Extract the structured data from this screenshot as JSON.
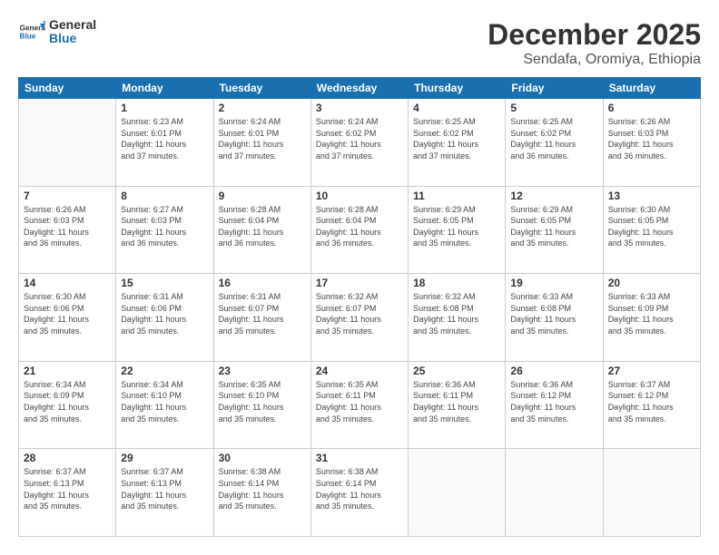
{
  "header": {
    "logo_general": "General",
    "logo_blue": "Blue",
    "month_year": "December 2025",
    "location": "Sendafa, Oromiya, Ethiopia"
  },
  "weekdays": [
    "Sunday",
    "Monday",
    "Tuesday",
    "Wednesday",
    "Thursday",
    "Friday",
    "Saturday"
  ],
  "weeks": [
    [
      {
        "day": "",
        "info": ""
      },
      {
        "day": "1",
        "info": "Sunrise: 6:23 AM\nSunset: 6:01 PM\nDaylight: 11 hours\nand 37 minutes."
      },
      {
        "day": "2",
        "info": "Sunrise: 6:24 AM\nSunset: 6:01 PM\nDaylight: 11 hours\nand 37 minutes."
      },
      {
        "day": "3",
        "info": "Sunrise: 6:24 AM\nSunset: 6:02 PM\nDaylight: 11 hours\nand 37 minutes."
      },
      {
        "day": "4",
        "info": "Sunrise: 6:25 AM\nSunset: 6:02 PM\nDaylight: 11 hours\nand 37 minutes."
      },
      {
        "day": "5",
        "info": "Sunrise: 6:25 AM\nSunset: 6:02 PM\nDaylight: 11 hours\nand 36 minutes."
      },
      {
        "day": "6",
        "info": "Sunrise: 6:26 AM\nSunset: 6:03 PM\nDaylight: 11 hours\nand 36 minutes."
      }
    ],
    [
      {
        "day": "7",
        "info": "Sunrise: 6:26 AM\nSunset: 6:03 PM\nDaylight: 11 hours\nand 36 minutes."
      },
      {
        "day": "8",
        "info": "Sunrise: 6:27 AM\nSunset: 6:03 PM\nDaylight: 11 hours\nand 36 minutes."
      },
      {
        "day": "9",
        "info": "Sunrise: 6:28 AM\nSunset: 6:04 PM\nDaylight: 11 hours\nand 36 minutes."
      },
      {
        "day": "10",
        "info": "Sunrise: 6:28 AM\nSunset: 6:04 PM\nDaylight: 11 hours\nand 36 minutes."
      },
      {
        "day": "11",
        "info": "Sunrise: 6:29 AM\nSunset: 6:05 PM\nDaylight: 11 hours\nand 35 minutes."
      },
      {
        "day": "12",
        "info": "Sunrise: 6:29 AM\nSunset: 6:05 PM\nDaylight: 11 hours\nand 35 minutes."
      },
      {
        "day": "13",
        "info": "Sunrise: 6:30 AM\nSunset: 6:05 PM\nDaylight: 11 hours\nand 35 minutes."
      }
    ],
    [
      {
        "day": "14",
        "info": "Sunrise: 6:30 AM\nSunset: 6:06 PM\nDaylight: 11 hours\nand 35 minutes."
      },
      {
        "day": "15",
        "info": "Sunrise: 6:31 AM\nSunset: 6:06 PM\nDaylight: 11 hours\nand 35 minutes."
      },
      {
        "day": "16",
        "info": "Sunrise: 6:31 AM\nSunset: 6:07 PM\nDaylight: 11 hours\nand 35 minutes."
      },
      {
        "day": "17",
        "info": "Sunrise: 6:32 AM\nSunset: 6:07 PM\nDaylight: 11 hours\nand 35 minutes."
      },
      {
        "day": "18",
        "info": "Sunrise: 6:32 AM\nSunset: 6:08 PM\nDaylight: 11 hours\nand 35 minutes."
      },
      {
        "day": "19",
        "info": "Sunrise: 6:33 AM\nSunset: 6:08 PM\nDaylight: 11 hours\nand 35 minutes."
      },
      {
        "day": "20",
        "info": "Sunrise: 6:33 AM\nSunset: 6:09 PM\nDaylight: 11 hours\nand 35 minutes."
      }
    ],
    [
      {
        "day": "21",
        "info": "Sunrise: 6:34 AM\nSunset: 6:09 PM\nDaylight: 11 hours\nand 35 minutes."
      },
      {
        "day": "22",
        "info": "Sunrise: 6:34 AM\nSunset: 6:10 PM\nDaylight: 11 hours\nand 35 minutes."
      },
      {
        "day": "23",
        "info": "Sunrise: 6:35 AM\nSunset: 6:10 PM\nDaylight: 11 hours\nand 35 minutes."
      },
      {
        "day": "24",
        "info": "Sunrise: 6:35 AM\nSunset: 6:11 PM\nDaylight: 11 hours\nand 35 minutes."
      },
      {
        "day": "25",
        "info": "Sunrise: 6:36 AM\nSunset: 6:11 PM\nDaylight: 11 hours\nand 35 minutes."
      },
      {
        "day": "26",
        "info": "Sunrise: 6:36 AM\nSunset: 6:12 PM\nDaylight: 11 hours\nand 35 minutes."
      },
      {
        "day": "27",
        "info": "Sunrise: 6:37 AM\nSunset: 6:12 PM\nDaylight: 11 hours\nand 35 minutes."
      }
    ],
    [
      {
        "day": "28",
        "info": "Sunrise: 6:37 AM\nSunset: 6:13 PM\nDaylight: 11 hours\nand 35 minutes."
      },
      {
        "day": "29",
        "info": "Sunrise: 6:37 AM\nSunset: 6:13 PM\nDaylight: 11 hours\nand 35 minutes."
      },
      {
        "day": "30",
        "info": "Sunrise: 6:38 AM\nSunset: 6:14 PM\nDaylight: 11 hours\nand 35 minutes."
      },
      {
        "day": "31",
        "info": "Sunrise: 6:38 AM\nSunset: 6:14 PM\nDaylight: 11 hours\nand 35 minutes."
      },
      {
        "day": "",
        "info": ""
      },
      {
        "day": "",
        "info": ""
      },
      {
        "day": "",
        "info": ""
      }
    ]
  ]
}
